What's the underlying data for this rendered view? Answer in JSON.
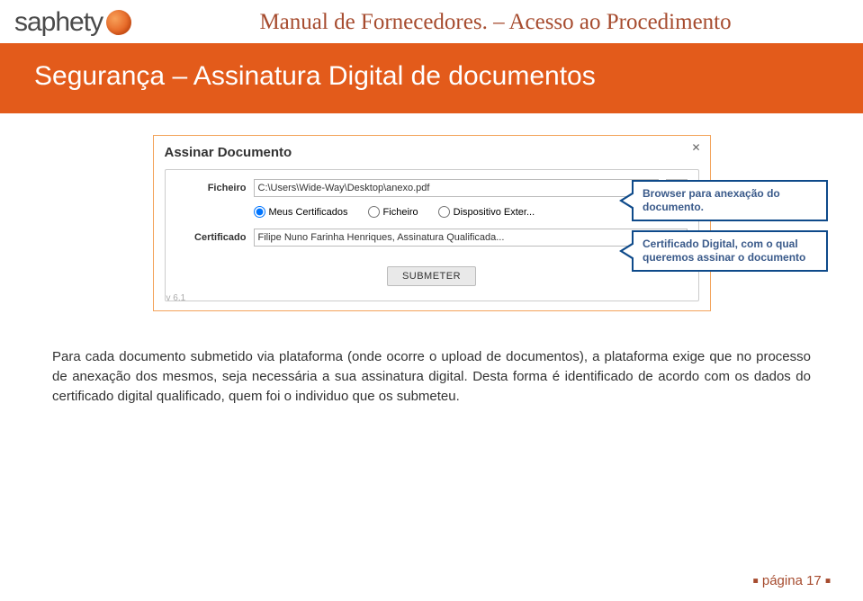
{
  "logo": {
    "text": "saphety"
  },
  "header": {
    "title": "Manual de Fornecedores. – Acesso ao Procedimento"
  },
  "banner": {
    "text": "Segurança – Assinatura Digital de documentos"
  },
  "dialog": {
    "title": "Assinar Documento",
    "close": "✕",
    "ficheiro_label": "Ficheiro",
    "ficheiro_value": "C:\\Users\\Wide-Way\\Desktop\\anexo.pdf",
    "browse": "...",
    "radio1": "Meus Certificados",
    "radio2": "Ficheiro",
    "radio3": "Dispositivo Exter...",
    "cert_label": "Certificado",
    "cert_value": "Filipe Nuno Farinha Henriques, Assinatura Qualificada...",
    "submit": "SUBMETER",
    "version": "v 6.1"
  },
  "callouts": {
    "c1": "Browser para anexação do documento.",
    "c2": "Certificado Digital, com o qual queremos assinar o documento"
  },
  "body": "Para cada documento submetido via plataforma (onde ocorre o upload de documentos), a plataforma exige que no processo de anexação dos mesmos, seja necessária a sua assinatura digital. Desta forma é identificado de acordo com os dados do certificado digital qualificado, quem foi o individuo que os submeteu.",
  "footer": {
    "page": "página 17"
  }
}
